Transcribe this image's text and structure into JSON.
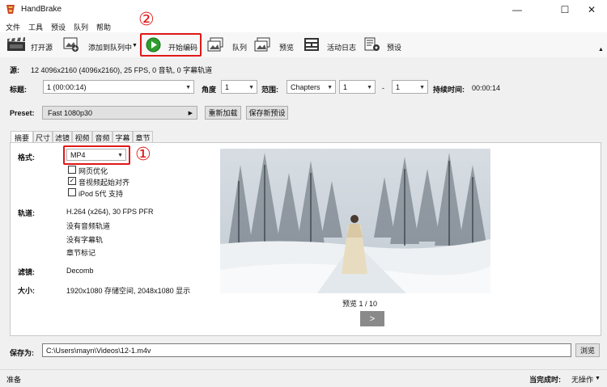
{
  "window": {
    "title": "HandBrake",
    "minimize": "—",
    "maximize": "☐",
    "close": "✕"
  },
  "menu": [
    "文件",
    "工具",
    "预设",
    "队列",
    "帮助"
  ],
  "toolbar": {
    "open_source": "打开源",
    "add_to_queue": "添加到队列中",
    "start_encode": "开始编码",
    "queue": "队列",
    "preview": "预览",
    "activity_log": "活动日志",
    "presets": "预设"
  },
  "source": {
    "label": "源:",
    "value": "12  4096x2160 (4096x2160), 25 FPS, 0 音轨, 0 字幕轨道"
  },
  "title_row": {
    "title_label": "标题:",
    "title_value": "1 (00:00:14)",
    "angle_label": "角度",
    "angle_value": "1",
    "range_label": "范围:",
    "range_type": "Chapters",
    "range_start": "1",
    "range_dash": "-",
    "range_end": "1",
    "duration_label": "持续时间:",
    "duration_value": "00:00:14"
  },
  "preset": {
    "label": "Preset:",
    "value": "Fast 1080p30",
    "reload_button": "重新加载",
    "save_new_button": "保存新预设"
  },
  "tabs": [
    "摘要",
    "尺寸",
    "滤镜",
    "视频",
    "音频",
    "字幕",
    "章节"
  ],
  "summary": {
    "format_label": "格式:",
    "format_value": "MP4",
    "options": [
      {
        "label": "网页优化",
        "checked": false
      },
      {
        "label": "音视频起始对齐",
        "checked": true
      },
      {
        "label": "iPod 5代 支持",
        "checked": false
      }
    ],
    "tracks_label": "轨道:",
    "tracks": [
      "H.264 (x264), 30 FPS PFR",
      "没有音频轨道",
      "没有字幕轨",
      "章节标记"
    ],
    "filters_label": "滤镜:",
    "filters_value": "Decomb",
    "size_label": "大小:",
    "size_value": "1920x1080 存储空间, 2048x1080 显示"
  },
  "preview": {
    "caption": "预览 1 / 10",
    "next_button": ">"
  },
  "save_as": {
    "label": "保存为:",
    "path": "C:\\Users\\mayn\\Videos\\12-1.m4v",
    "browse_button": "浏览"
  },
  "status": {
    "text": "准备",
    "when_done_label": "当完成时:",
    "when_done_value": "无操作"
  },
  "annotations": {
    "marker_1": "①",
    "marker_2": "②"
  },
  "colors": {
    "annotation_red": "#e01818",
    "play_green": "#2e9e2e"
  }
}
